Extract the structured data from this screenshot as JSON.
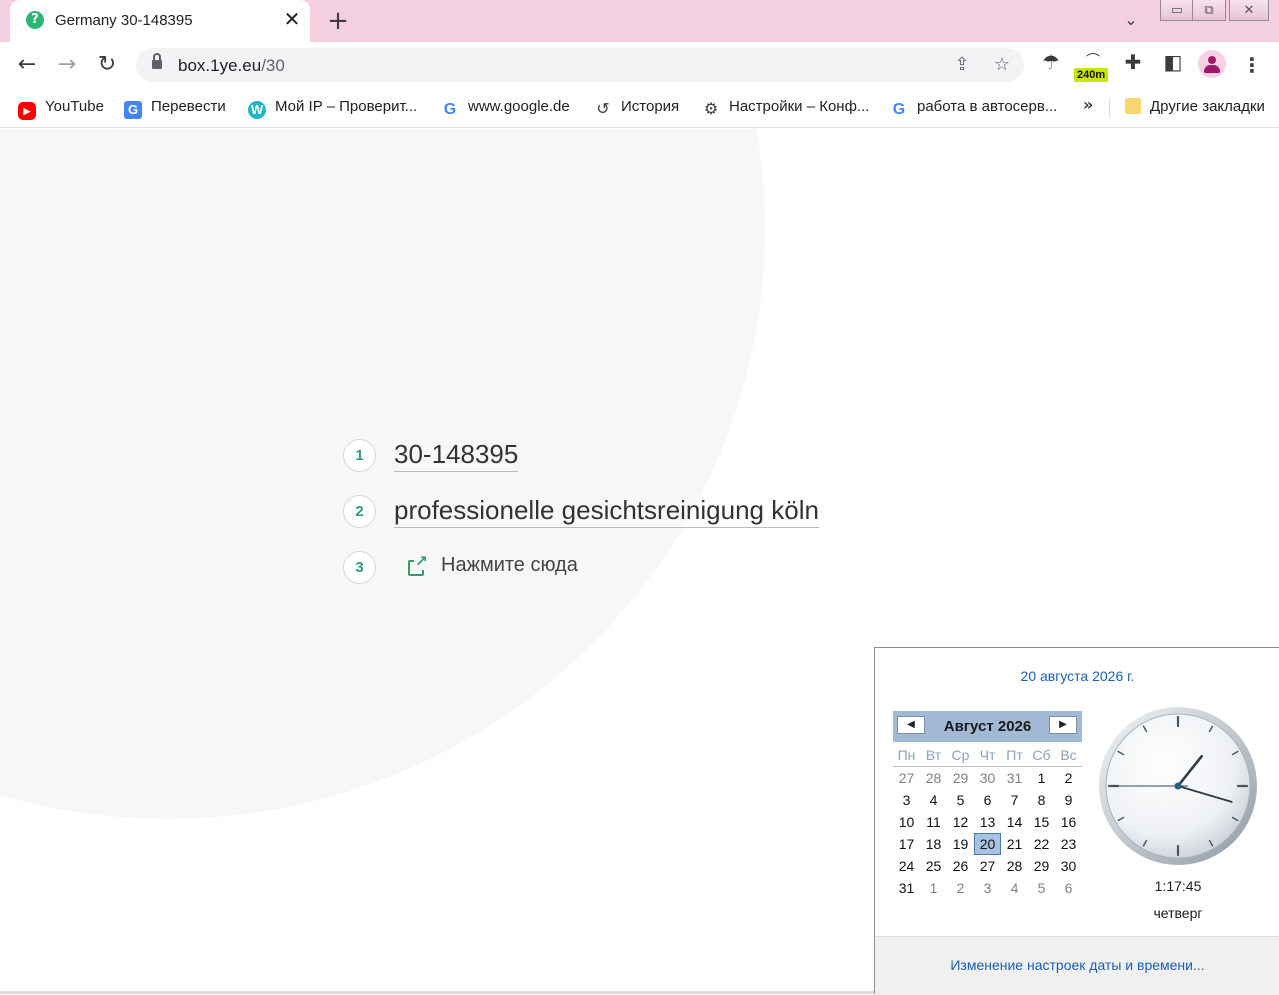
{
  "browser": {
    "tab": {
      "title": "Germany 30-148395",
      "favicon": "?"
    },
    "new_tab": "+",
    "url": {
      "host": "box.1ye.eu",
      "path": "/30"
    },
    "extension_badge": "240m",
    "bookmarks": [
      {
        "label": "YouTube",
        "icon": "youtube-icon"
      },
      {
        "label": "Перевести",
        "icon": "translate-icon"
      },
      {
        "label": "Мой IP – Проверит...",
        "icon": "w-icon"
      },
      {
        "label": "www.google.de",
        "icon": "google-icon"
      },
      {
        "label": "История",
        "icon": "history-icon"
      },
      {
        "label": "Настройки – Конф...",
        "icon": "gear-icon"
      },
      {
        "label": "работа в автосерв...",
        "icon": "google-icon"
      }
    ],
    "bookmarks_more": "»",
    "other_bookmarks": "Другие закладки"
  },
  "page": {
    "steps": [
      {
        "num": "1",
        "text": "30-148395"
      },
      {
        "num": "2",
        "text": "professionelle gesichtsreinigung köln"
      },
      {
        "num": "3",
        "text": "Нажмите сюда"
      }
    ],
    "accent_color": "#2f9e6b"
  },
  "calendar_popup": {
    "full_date": "20 августа 2026 г.",
    "month_title": "Август 2026",
    "weekdays": [
      "Пн",
      "Вт",
      "Ср",
      "Чт",
      "Пт",
      "Сб",
      "Вс"
    ],
    "weeks": [
      [
        "27",
        "28",
        "29",
        "30",
        "31",
        "1",
        "2"
      ],
      [
        "3",
        "4",
        "5",
        "6",
        "7",
        "8",
        "9"
      ],
      [
        "10",
        "11",
        "12",
        "13",
        "14",
        "15",
        "16"
      ],
      [
        "17",
        "18",
        "19",
        "20",
        "21",
        "22",
        "23"
      ],
      [
        "24",
        "25",
        "26",
        "27",
        "28",
        "29",
        "30"
      ],
      [
        "31",
        "1",
        "2",
        "3",
        "4",
        "5",
        "6"
      ]
    ],
    "other_month": [
      [
        true,
        true,
        true,
        true,
        true,
        false,
        false
      ],
      [
        false,
        false,
        false,
        false,
        false,
        false,
        false
      ],
      [
        false,
        false,
        false,
        false,
        false,
        false,
        false
      ],
      [
        false,
        false,
        false,
        false,
        false,
        false,
        false
      ],
      [
        false,
        false,
        false,
        false,
        false,
        false,
        false
      ],
      [
        false,
        true,
        true,
        true,
        true,
        true,
        true
      ]
    ],
    "today": "20",
    "time": "1:17:45",
    "weekday": "четверг",
    "footer_link": "Изменение настроек даты и времени..."
  }
}
